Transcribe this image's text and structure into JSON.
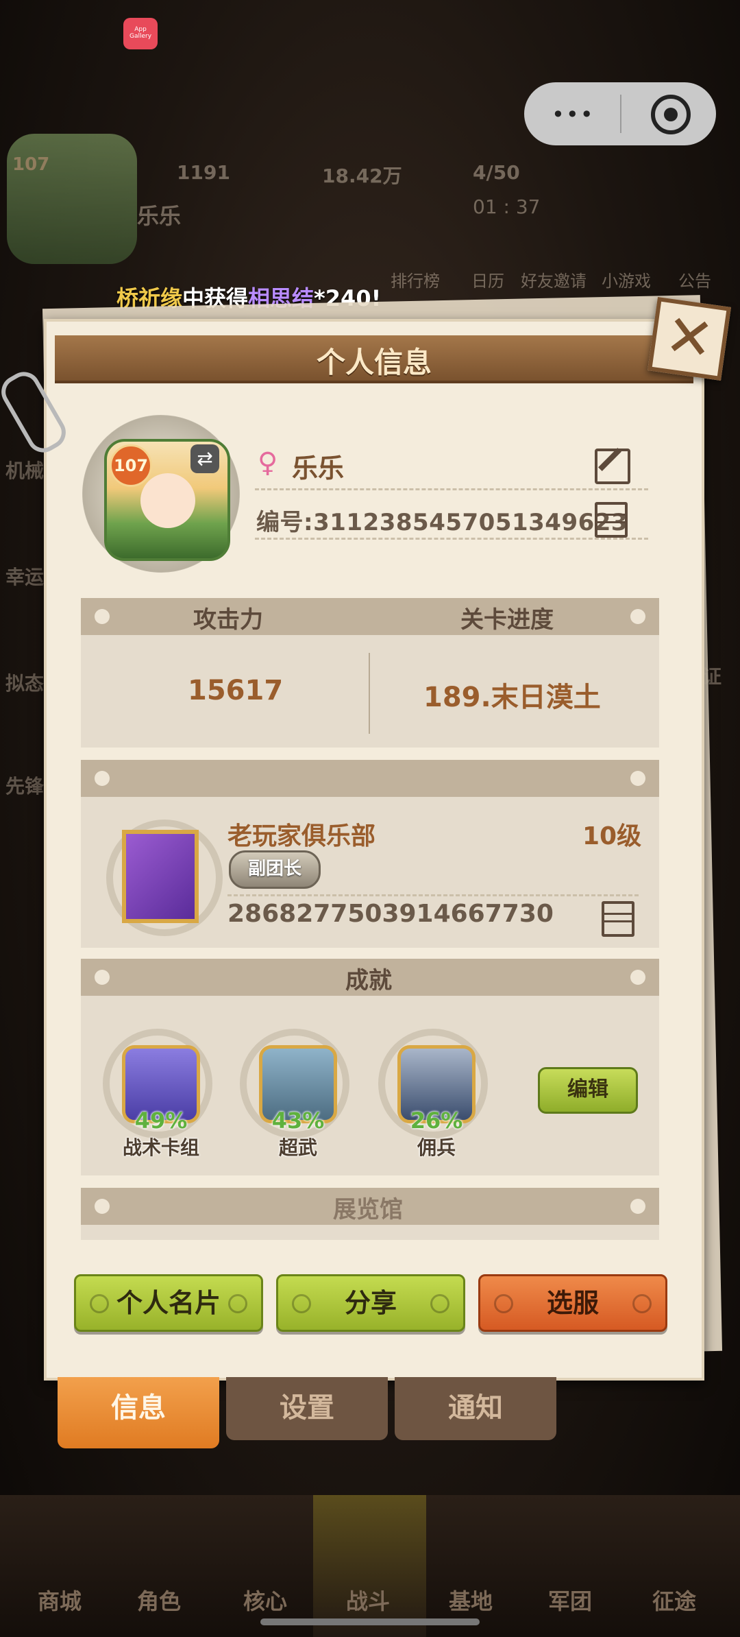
{
  "status_bar": {
    "app_badge": "App Gallery"
  },
  "mini_program_menu": {
    "dots": "•••"
  },
  "hud": {
    "level": "107",
    "player_name": "乐乐",
    "resources": [
      "1191",
      "18.42万",
      "4/50"
    ],
    "timer": "01 : 37",
    "toolbar": [
      "排行榜",
      "日历",
      "好友邀请",
      "小游戏",
      "公告"
    ]
  },
  "side_labels": [
    "机械",
    "幸运",
    "拟态",
    "先锋",
    "证"
  ],
  "ticker": {
    "part1": "桥祈缘",
    "part2": "中获得",
    "part3": "相思结",
    "part4": "*240!"
  },
  "panel": {
    "title": "个人信息",
    "close_symbol": "✕",
    "profile": {
      "level": "107",
      "swap_symbol": "⇄",
      "gender_symbol": "♀",
      "name": "乐乐",
      "id_text": "编号:3112385457051349623"
    },
    "stats": {
      "attack_label": "攻击力",
      "progress_label": "关卡进度",
      "attack_value": "15617",
      "progress_value": "189.末日漠土"
    },
    "club": {
      "name": "老玩家俱乐部",
      "level": "10级",
      "role": "副团长",
      "id": "2868277503914667730"
    },
    "achievements": {
      "title": "成就",
      "items": [
        {
          "percent": "49%",
          "name": "战术卡组",
          "icon": "tactic-card-icon"
        },
        {
          "percent": "43%",
          "name": "超武",
          "icon": "super-weapon-icon"
        },
        {
          "percent": "26%",
          "name": "佣兵",
          "icon": "mercenary-icon"
        }
      ],
      "edit_label": "编辑"
    },
    "gallery": {
      "title": "展览馆"
    },
    "buttons": {
      "card": "个人名片",
      "share": "分享",
      "server": "选服"
    }
  },
  "tabs": [
    {
      "label": "信息",
      "active": true
    },
    {
      "label": "设置",
      "active": false
    },
    {
      "label": "通知",
      "active": false
    }
  ],
  "bottom_nav": [
    "商城",
    "角色",
    "核心",
    "战斗",
    "基地",
    "军团",
    "征途"
  ],
  "colors": {
    "accent_orange": "#e07b22",
    "button_green": "#98b22a",
    "title_brown": "#7a522e"
  }
}
